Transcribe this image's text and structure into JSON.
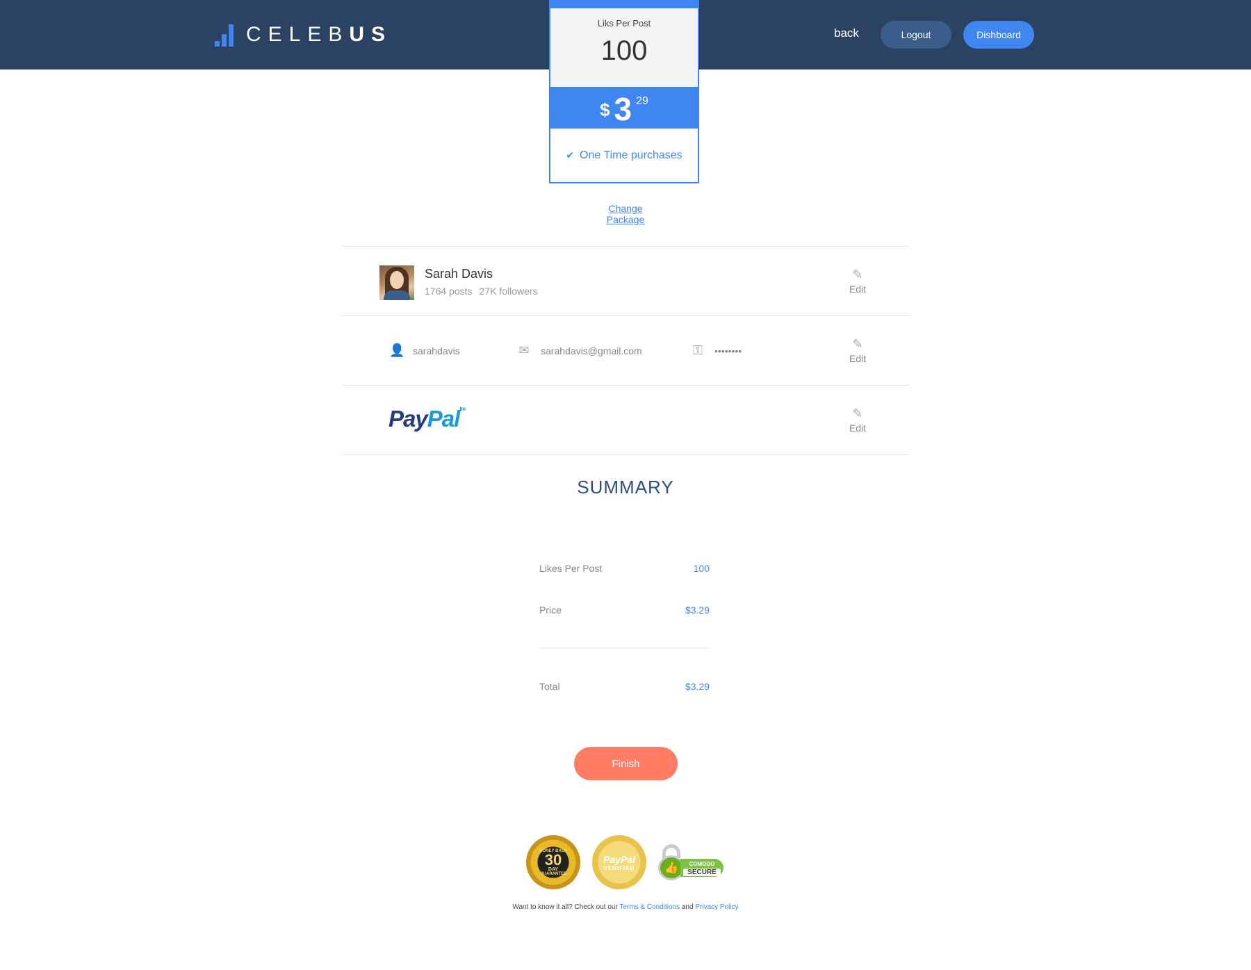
{
  "header": {
    "logo_light": "CELEB",
    "logo_bold": "US",
    "back_label": "back",
    "logout_label": "Logout",
    "dashboard_label": "Dishboard"
  },
  "package": {
    "label": "Liks Per Post",
    "value": "100",
    "currency": "$",
    "price_int": "3",
    "price_cents": "29",
    "feature": "One Time purchases",
    "change_label": "Change Package"
  },
  "profile": {
    "name": "Sarah Davis",
    "posts": "1764 posts",
    "followers": "27K followers",
    "edit_label": "Edit"
  },
  "credentials": {
    "username": "sarahdavis",
    "email": "sarahdavis@gmail.com",
    "password": "••••••••",
    "edit_label": "Edit"
  },
  "payment": {
    "brand_part1": "Pay",
    "brand_part2": "Pal",
    "trademark": "tm",
    "edit_label": "Edit"
  },
  "summary": {
    "title": "SUMMARY",
    "rows": [
      {
        "label": "Likes Per Post",
        "value": "100"
      },
      {
        "label": "Price",
        "value": "$3.29"
      }
    ],
    "total_label": "Total",
    "total_value": "$3.29",
    "finish_label": "Finish"
  },
  "badges": {
    "money_top": "MONEY BACK",
    "money_num": "30",
    "money_day": "DAY",
    "money_bottom": "GUARANTEE",
    "paypal_brand": "PayPal",
    "paypal_verified": "VERIFIED",
    "comodo_brand": "COMODO",
    "comodo_secure": "SECURE"
  },
  "footer": {
    "text": "Want to know it all? Check out our",
    "terms": "Terms & Conditions",
    "and": "and",
    "privacy": "Privacy Policy"
  },
  "colors": {
    "header_bg": "#2b4262",
    "accent": "#3f86f0",
    "finish": "#ff7b63",
    "logout_bg": "#3a5d8c"
  }
}
